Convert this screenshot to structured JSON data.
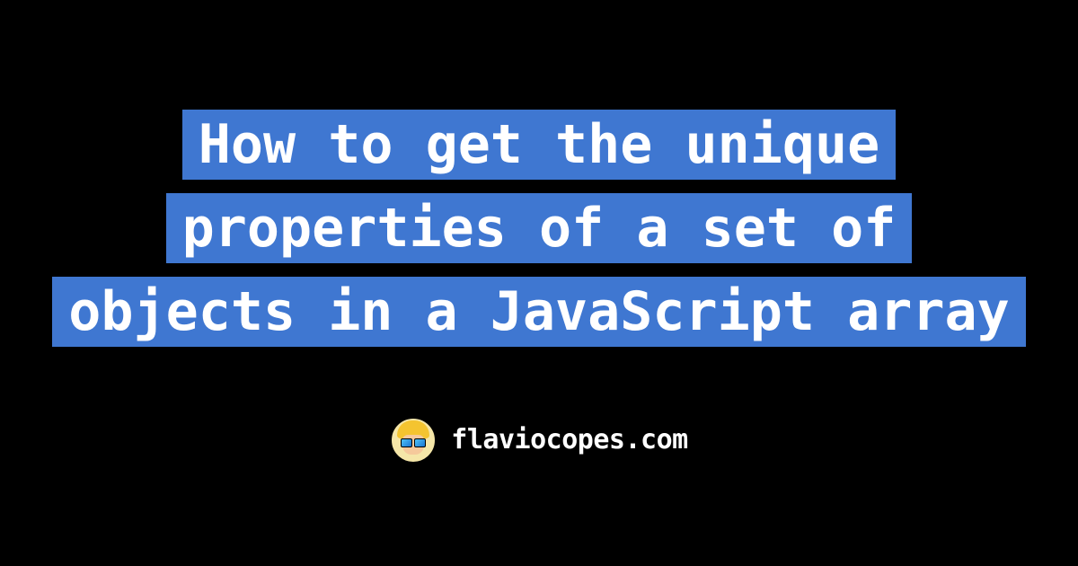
{
  "title": "How to get the unique properties of a set of objects in a JavaScript array",
  "site_name": "flaviocopes.com",
  "colors": {
    "background": "#000000",
    "highlight": "#3f77d1",
    "text": "#ffffff"
  }
}
